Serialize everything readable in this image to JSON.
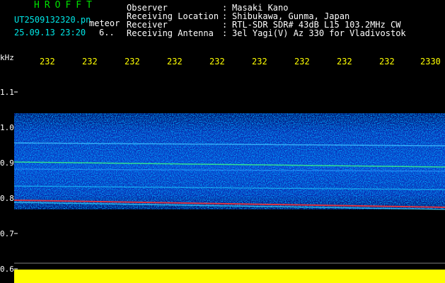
{
  "header": {
    "app_title": "HROFFT",
    "file_name": "UT2509132320.pn",
    "file_suffix": "meteor",
    "date_time": "25.09.13 23:20",
    "date_extra": "6.."
  },
  "info": [
    {
      "label": "Observer",
      "value": "Masaki Kano"
    },
    {
      "label": "Receiving Location",
      "value": "Shibukawa, Gunma, Japan"
    },
    {
      "label": "Receiver",
      "value": "RTL-SDR SDR# 43dB L15 103.2MHz CW"
    },
    {
      "label": "Receiving Antenna",
      "value": "3el Yagi(V) Az 330 for Vladivostok"
    }
  ],
  "axis": {
    "y_unit": "kHz",
    "y_ticks": [
      "1.1",
      "1.0",
      "0.9",
      "0.8",
      "0.7",
      "0.6"
    ],
    "x_ticks": [
      "232",
      "232",
      "232",
      "232",
      "232",
      "232",
      "232",
      "232",
      "232",
      "2330"
    ]
  },
  "colors": {
    "background": "#000000",
    "header_green": "#00e000",
    "header_cyan": "#00e5e5",
    "tick_yellow": "#ffff00",
    "signal_low": "#0010a0",
    "signal_mid": "#00b0ff",
    "signal_high": "#40ff40",
    "signal_peak": "#ff2020"
  }
}
